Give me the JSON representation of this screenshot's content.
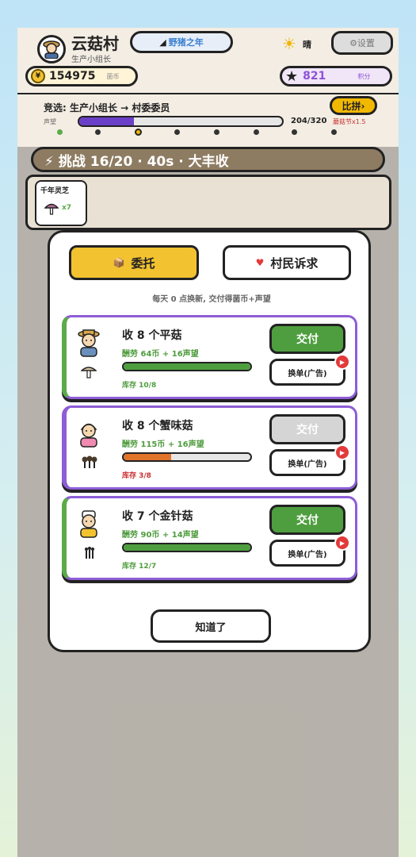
{
  "header": {
    "village_name": "云菇村",
    "role": "生产小组长",
    "event_label": "野猪之年",
    "weather": "晴",
    "settings_label": "⚙设置",
    "coins": "154975",
    "coins_label": "菌币",
    "points": "821",
    "points_label": "积分"
  },
  "competition": {
    "text": "竞选: 生产小组长 → 村委委员",
    "button": "比拼›",
    "rep_label": "声望",
    "rep_value": "204/320",
    "rep_progress": 0.27,
    "festival": "蘑菇节x1.5"
  },
  "challenge": {
    "text": "⚡ 挑战 16/20 · 40s · 大丰收",
    "item_name": "千年灵芝",
    "item_qty": "x7"
  },
  "modal": {
    "tab_commission": "委托",
    "tab_requests": "村民诉求",
    "subtitle": "每天 0 点换新, 交付得菌币+声望",
    "close_button": "知道了",
    "orders": [
      {
        "title": "收 8 个平菇",
        "reward": "酬劳 64币 + 16声望",
        "stock": "库存 10/8",
        "progress": 1.0,
        "fill_color": "#4e9e3f",
        "deliver": "交付",
        "deliverable": true,
        "swap": "换单(广告)"
      },
      {
        "title": "收 8 个蟹味菇",
        "reward": "酬劳 115币 + 16声望",
        "stock": "库存 3/8",
        "progress": 0.375,
        "fill_color": "#e0742a",
        "deliver": "交付",
        "deliverable": false,
        "swap": "换单(广告)"
      },
      {
        "title": "收 7 个金针菇",
        "reward": "酬劳 90币 + 14声望",
        "stock": "库存 12/7",
        "progress": 1.0,
        "fill_color": "#4e9e3f",
        "deliver": "交付",
        "deliverable": true,
        "swap": "换单(广告)"
      }
    ]
  }
}
